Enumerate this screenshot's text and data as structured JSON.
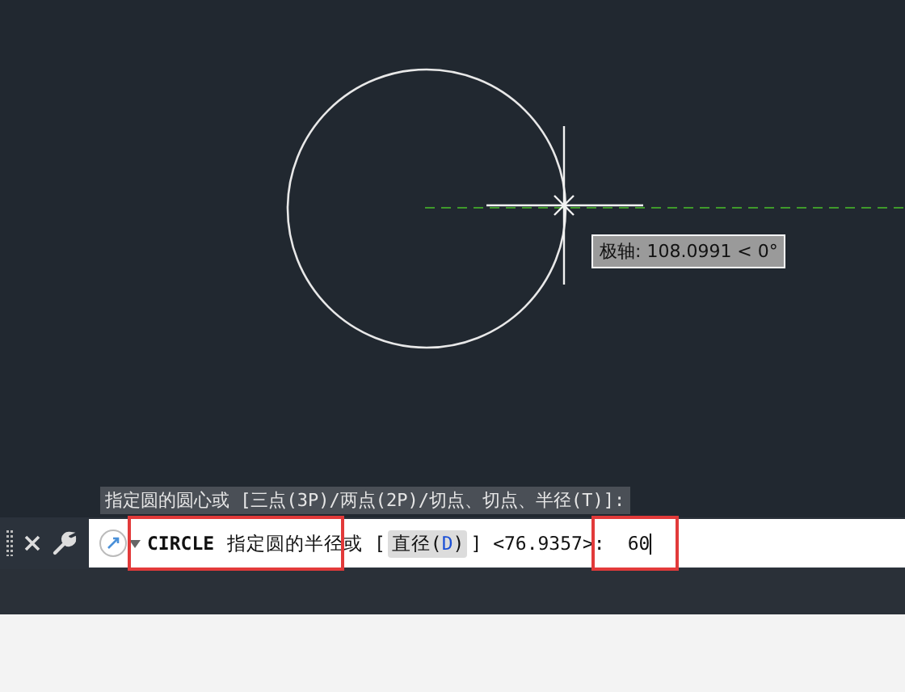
{
  "canvas": {
    "tooltip": "极轴: 108.0991 < 0°"
  },
  "command_history": "指定圆的圆心或 [三点(3P)/两点(2P)/切点、切点、半径(T)]:",
  "command_line": {
    "command": "CIRCLE",
    "prompt": "指定圆的半径或 [",
    "option": {
      "text_before": "直径(",
      "key": "D",
      "text_after": ")"
    },
    "prompt_end": "] <76.9357>:",
    "value": "60"
  }
}
